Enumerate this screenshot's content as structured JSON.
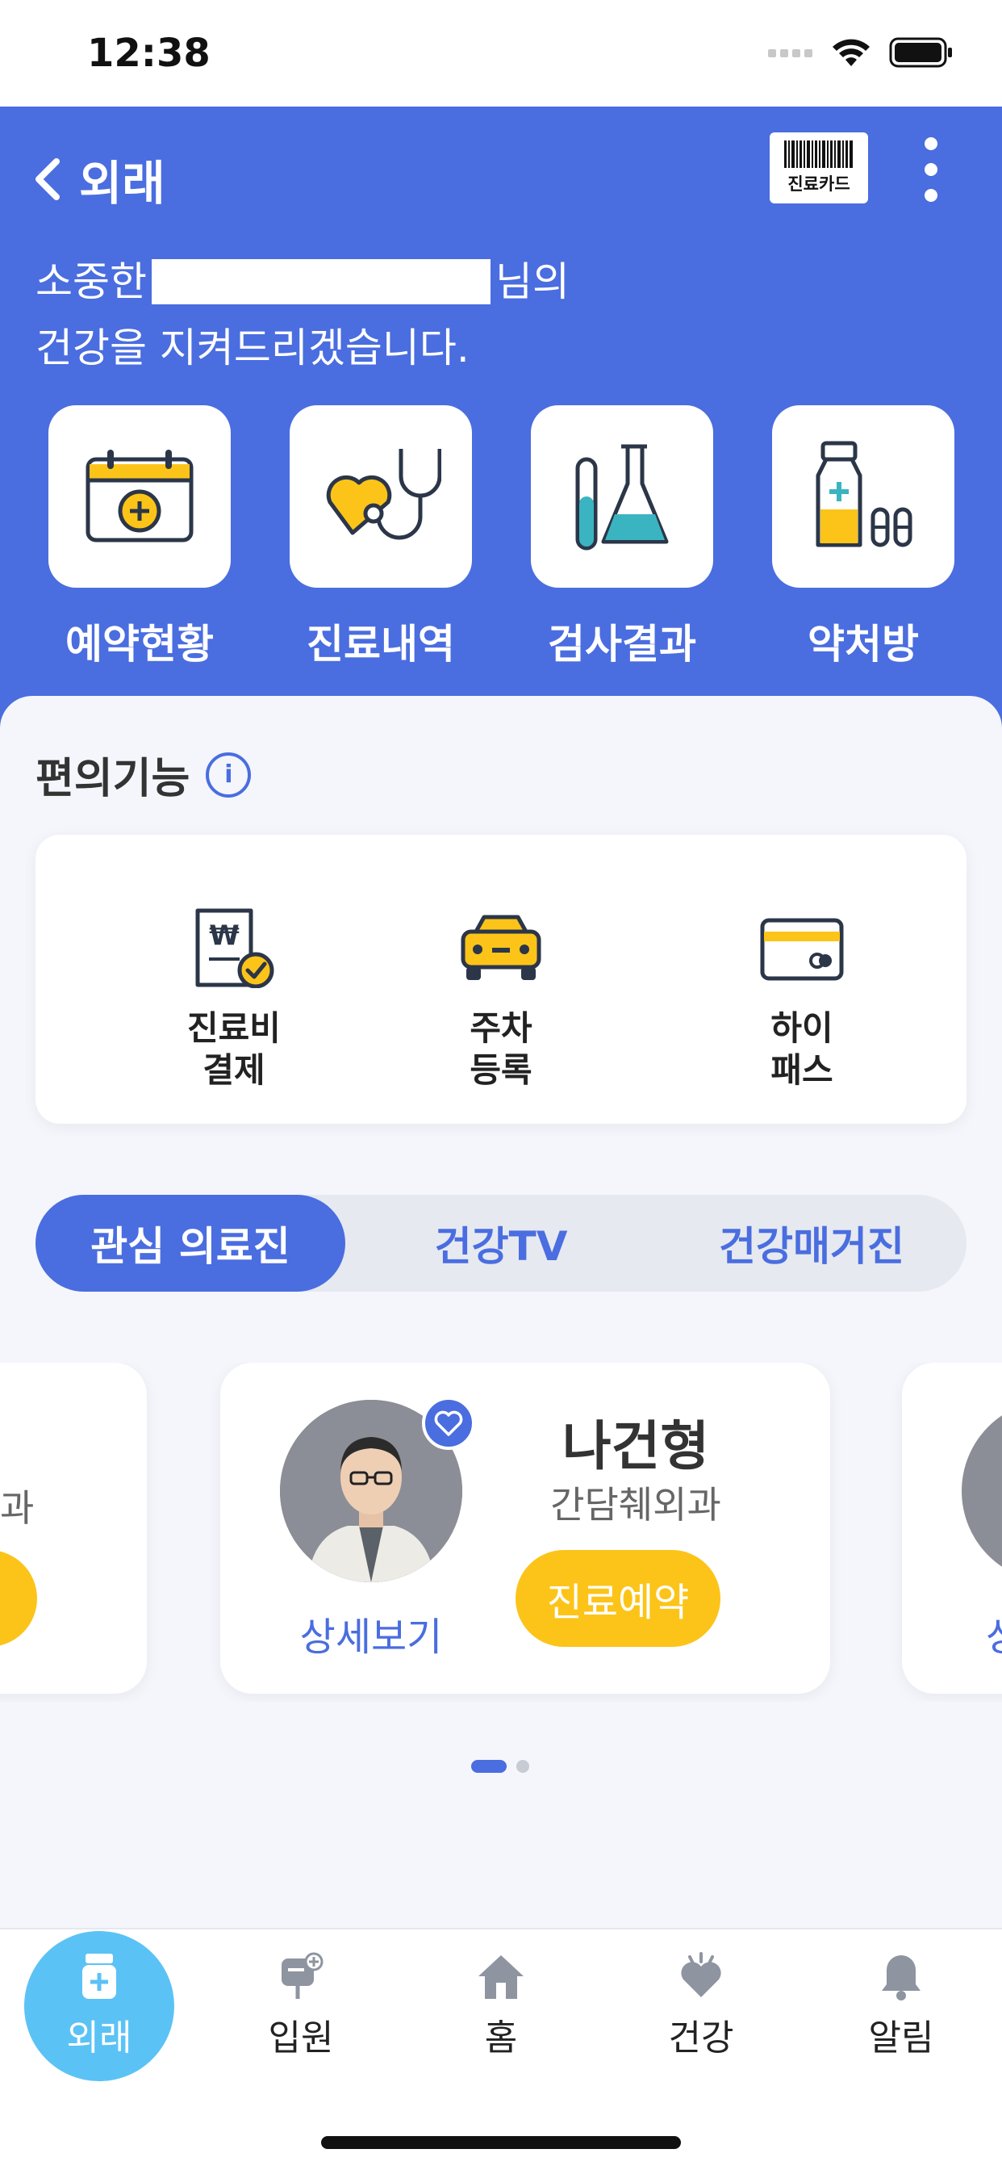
{
  "status_bar": {
    "time": "12:38"
  },
  "header": {
    "title": "외래",
    "card_button_label": "진료카드",
    "greeting_prefix": "소중한",
    "greeting_suffix": "님의",
    "greeting_line2": "건강을 지켜드리겠습니다."
  },
  "quick_menu": [
    {
      "label": "예약현황",
      "icon": "calendar-plus-icon"
    },
    {
      "label": "진료내역",
      "icon": "stethoscope-heart-icon"
    },
    {
      "label": "검사결과",
      "icon": "test-tube-flask-icon"
    },
    {
      "label": "약처방",
      "icon": "medicine-bottle-icon"
    }
  ],
  "convenience": {
    "title": "편의기능",
    "items": [
      {
        "line1": "진료비",
        "line2": "결제",
        "icon": "payment-check-icon"
      },
      {
        "line1": "주차",
        "line2": "등록",
        "icon": "car-icon"
      },
      {
        "line1": "하이",
        "line2": "패스",
        "icon": "card-icon"
      }
    ]
  },
  "segments": {
    "tabs": [
      "관심 의료진",
      "건강TV",
      "건강매거진"
    ],
    "active": 0
  },
  "doctor_card": {
    "name": "나건형",
    "department": "간담췌외과",
    "detail_label": "상세보기",
    "book_label": "진료예약"
  },
  "side_cards": {
    "left_dept_fragment": "과",
    "right_detail_fragment": "상"
  },
  "carousel": {
    "pages": 2,
    "current": 1
  },
  "tabbar": {
    "items": [
      {
        "label": "외래",
        "icon": "medicine-jar-icon"
      },
      {
        "label": "입원",
        "icon": "iv-bag-icon"
      },
      {
        "label": "홈",
        "icon": "home-icon"
      },
      {
        "label": "건강",
        "icon": "heart-hand-icon"
      },
      {
        "label": "알림",
        "icon": "bell-icon"
      }
    ],
    "active": 0
  },
  "colors": {
    "primary": "#4a6de0",
    "accent_yellow": "#fcc419",
    "tab_active": "#5bc2f5",
    "background": "#f4f6fb"
  }
}
